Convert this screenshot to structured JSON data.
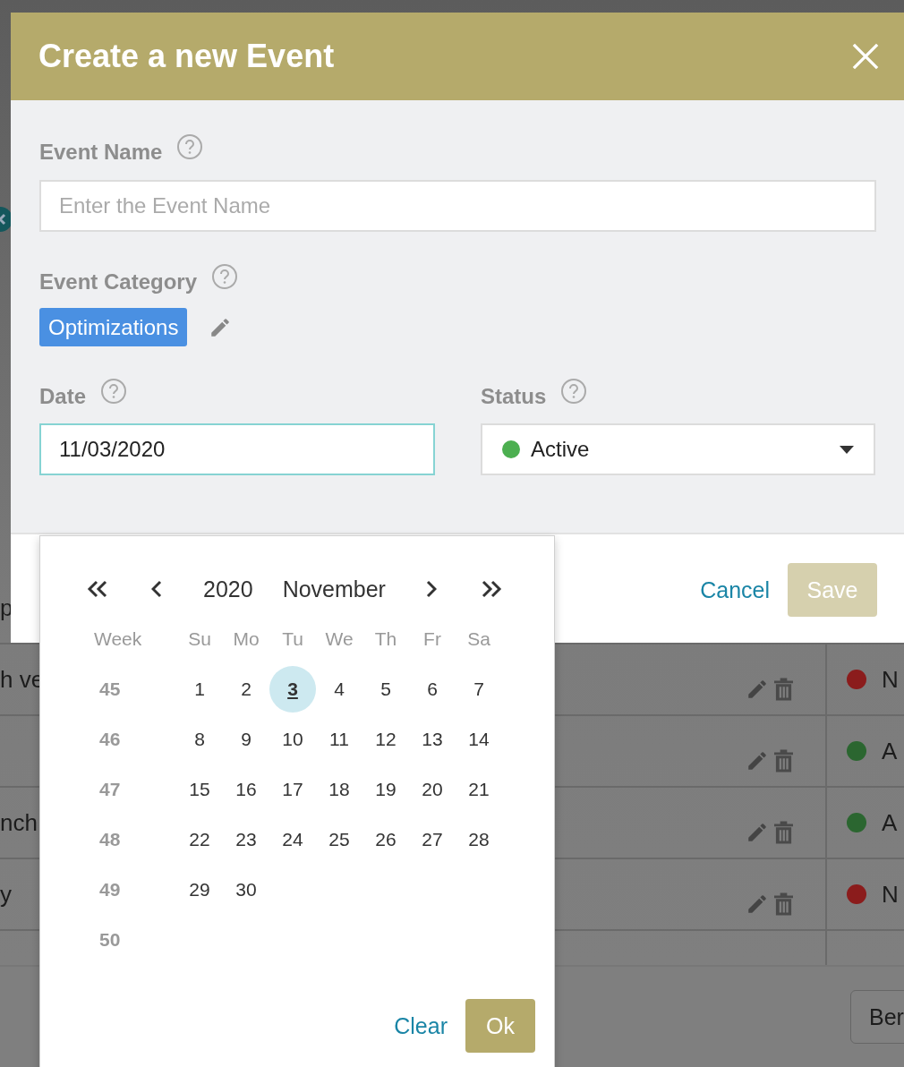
{
  "background": {
    "rows": [
      {
        "text": "p"
      },
      {
        "text": "h ve",
        "status": {
          "label": "N",
          "color": "#8b1c1c"
        }
      },
      {
        "status": {
          "label": "A",
          "color": "#2b6630"
        }
      },
      {
        "text": "nch",
        "status": {
          "label": "A",
          "color": "#2b6630"
        }
      },
      {
        "text": "y",
        "status": {
          "label": "N",
          "color": "#8b1c1c"
        }
      }
    ],
    "footer_button": "Ber"
  },
  "modal": {
    "title": "Create a new Event",
    "event_name": {
      "label": "Event Name",
      "placeholder": "Enter the Event Name"
    },
    "event_category": {
      "label": "Event Category",
      "tag": "Optimizations"
    },
    "date": {
      "label": "Date",
      "value": "11/03/2020",
      "focused": true
    },
    "status": {
      "label": "Status",
      "value": "Active",
      "color": "#4caf50"
    },
    "buttons": [
      {
        "label": "Cancel",
        "kind": "link"
      },
      {
        "label": "Save",
        "kind": "primary",
        "disabled": true
      }
    ]
  },
  "datepicker": {
    "year": "2020",
    "month": "November",
    "week_label": "Week",
    "weekdays": [
      "Su",
      "Mo",
      "Tu",
      "We",
      "Th",
      "Fr",
      "Sa"
    ],
    "weeks": [
      {
        "number": "45",
        "days": [
          {
            "label": "1",
            "selected": false
          },
          {
            "label": "2",
            "selected": false
          },
          {
            "label": "3",
            "selected": true
          },
          {
            "label": "4",
            "selected": false
          },
          {
            "label": "5",
            "selected": false
          },
          {
            "label": "6",
            "selected": false
          },
          {
            "label": "7",
            "selected": false
          }
        ]
      },
      {
        "number": "46",
        "days": [
          {
            "label": "8",
            "selected": false
          },
          {
            "label": "9",
            "selected": false
          },
          {
            "label": "10",
            "selected": false
          },
          {
            "label": "11",
            "selected": false
          },
          {
            "label": "12",
            "selected": false
          },
          {
            "label": "13",
            "selected": false
          },
          {
            "label": "14",
            "selected": false
          }
        ]
      },
      {
        "number": "47",
        "days": [
          {
            "label": "15",
            "selected": false
          },
          {
            "label": "16",
            "selected": false
          },
          {
            "label": "17",
            "selected": false
          },
          {
            "label": "18",
            "selected": false
          },
          {
            "label": "19",
            "selected": false
          },
          {
            "label": "20",
            "selected": false
          },
          {
            "label": "21",
            "selected": false
          }
        ]
      },
      {
        "number": "48",
        "days": [
          {
            "label": "22",
            "selected": false
          },
          {
            "label": "23",
            "selected": false
          },
          {
            "label": "24",
            "selected": false
          },
          {
            "label": "25",
            "selected": false
          },
          {
            "label": "26",
            "selected": false
          },
          {
            "label": "27",
            "selected": false
          },
          {
            "label": "28",
            "selected": false
          }
        ]
      },
      {
        "number": "49",
        "days": [
          {
            "label": "29",
            "selected": false
          },
          {
            "label": "30",
            "selected": false
          }
        ]
      },
      {
        "number": "50"
      }
    ],
    "buttons": [
      {
        "label": "Clear",
        "kind": "link"
      },
      {
        "label": "Ok",
        "kind": "primary"
      }
    ]
  }
}
